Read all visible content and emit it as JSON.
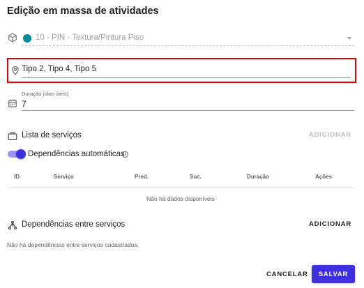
{
  "dialog": {
    "title": "Edição em massa de atividades"
  },
  "activity_select": {
    "value": "10 - PIN - Textura/Pintura Piso",
    "dot_color": "#008b9a",
    "icon": "cube-icon"
  },
  "location_field": {
    "value": "Tipo 2, Tipo 4, Tipo 5",
    "icon": "map-pin-icon"
  },
  "duration_field": {
    "label": "Duração (dias úteis)",
    "value": "7",
    "icon": "calendar-icon"
  },
  "services": {
    "title": "Lista de serviços",
    "add_label": "ADICIONAR",
    "auto_deps_label": "Dependências automáticas",
    "auto_deps_on": true,
    "columns": [
      "ID",
      "Serviço",
      "Pred.",
      "Suc.",
      "Duração",
      "Ações"
    ],
    "empty_text": "Não há dados disponíveis"
  },
  "dependencies": {
    "title": "Dependências entre serviços",
    "add_label": "ADICIONAR",
    "empty_text": "Não há dependências entre serviços cadastrados."
  },
  "footer": {
    "cancel_label": "CANCELAR",
    "save_label": "SALVAR"
  },
  "colors": {
    "primary": "#3d2ee0",
    "highlight": "#e00000"
  }
}
